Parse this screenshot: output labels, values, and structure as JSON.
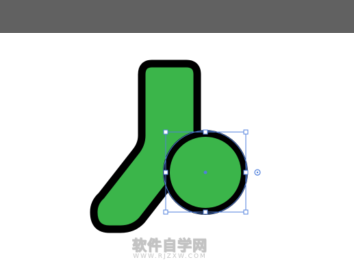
{
  "toolbar": {
    "color": "#616161"
  },
  "canvas": {
    "background": "#ffffff"
  },
  "artwork": {
    "shape_fill": "#3bb54a",
    "shape_stroke": "#000000",
    "selection_color": "#4f7fdc"
  },
  "watermark": {
    "chinese_text": "软件自学网",
    "url_text": "WWW.RJZXW.COM"
  }
}
